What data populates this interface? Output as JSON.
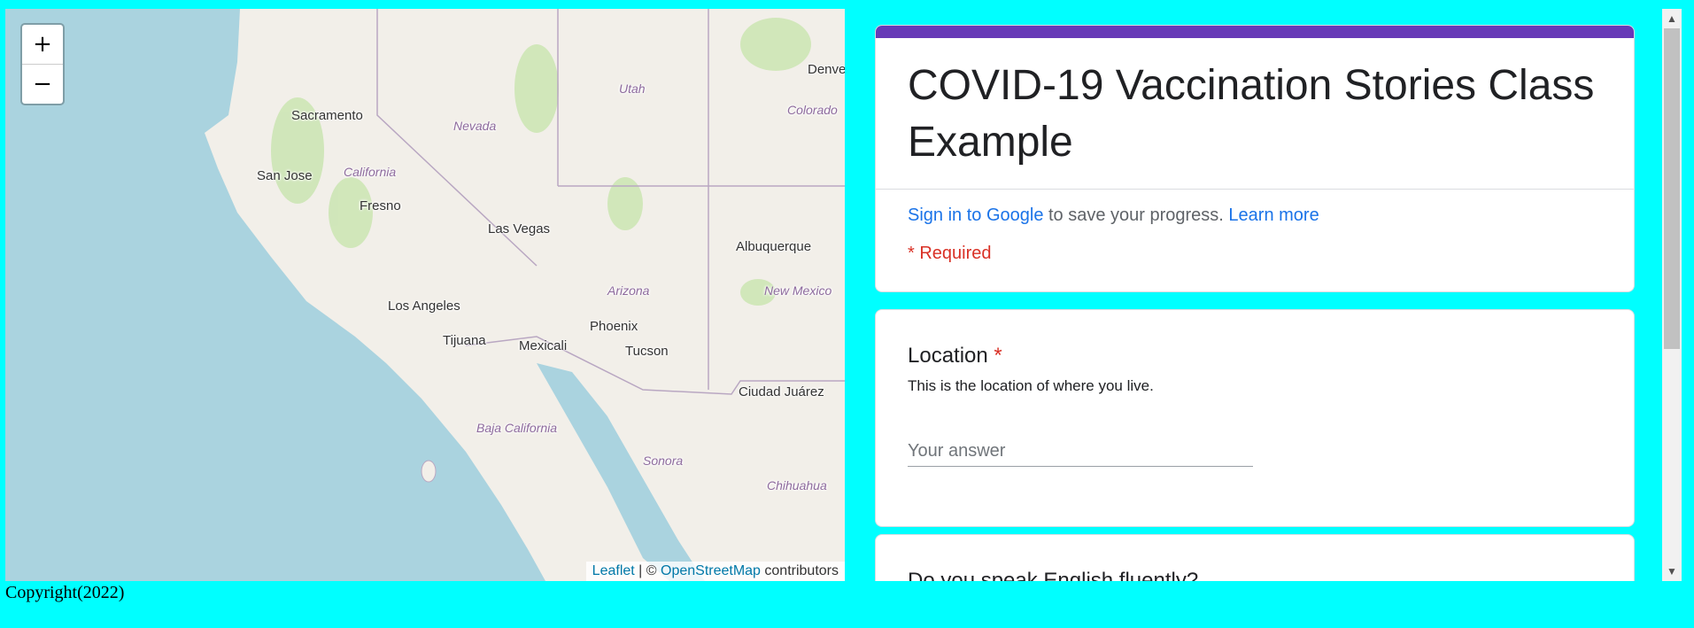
{
  "map": {
    "zoom_in": "+",
    "zoom_out": "−",
    "attribution": {
      "leaflet": "Leaflet",
      "separator": " | © ",
      "osm": "OpenStreetMap",
      "suffix": " contributors"
    },
    "cities": {
      "sacramento": "Sacramento",
      "san_jose": "San Jose",
      "fresno": "Fresno",
      "las_vegas": "Las Vegas",
      "los_angeles": "Los Angeles",
      "tijuana": "Tijuana",
      "mexicali": "Mexicali",
      "phoenix": "Phoenix",
      "tucson": "Tucson",
      "albuquerque": "Albuquerque",
      "ciudad_juarez": "Ciudad Juárez",
      "denver": "Denve"
    },
    "states": {
      "california": "California",
      "nevada": "Nevada",
      "utah": "Utah",
      "colorado": "Colorado",
      "arizona": "Arizona",
      "new_mexico": "New Mexico",
      "baja_california": "Baja California",
      "sonora": "Sonora",
      "chihuahua": "Chihuahua"
    }
  },
  "form": {
    "title": "COVID-19 Vaccination Stories Class Example",
    "signin_link": "Sign in to Google",
    "signin_text": " to save your progress. ",
    "learn_more": "Learn more",
    "required_note": "* Required",
    "q1": {
      "title": "Location",
      "required_mark": "*",
      "description": "This is the location of where you live.",
      "placeholder": "Your answer"
    },
    "q2": {
      "title": "Do you speak English fluently?"
    }
  },
  "footer": {
    "copyright": "Copyright(2022)"
  },
  "colors": {
    "background": "#00ffff",
    "form_accent": "#673ab7",
    "link": "#1a73e8",
    "required": "#d93025"
  }
}
